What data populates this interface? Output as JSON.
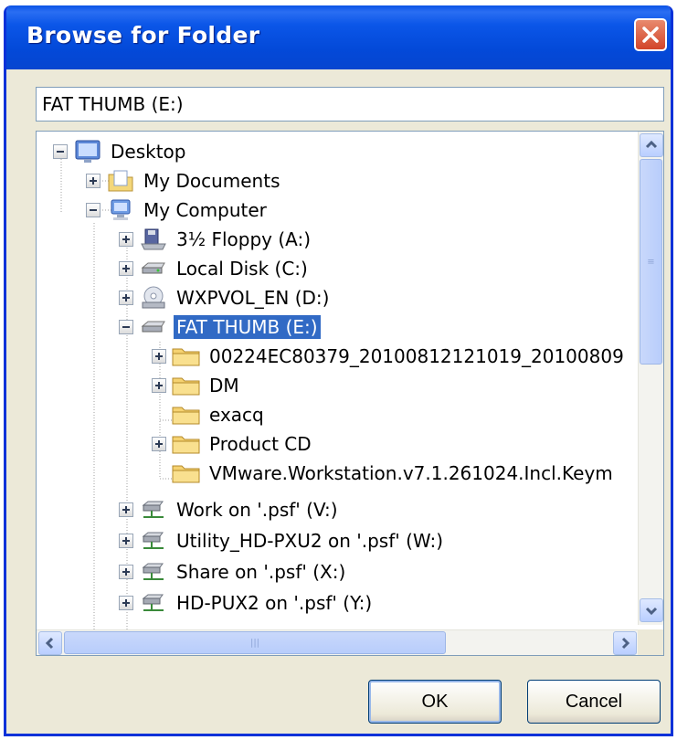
{
  "window": {
    "title": "Browse for Folder"
  },
  "path_field": {
    "value": "FAT THUMB (E:)"
  },
  "tree": {
    "items": [
      {
        "label": "Desktop",
        "icon": "desktop-icon",
        "expander": "minus"
      },
      {
        "label": "My Documents",
        "icon": "my-documents-icon",
        "expander": "plus"
      },
      {
        "label": "My Computer",
        "icon": "my-computer-icon",
        "expander": "minus"
      },
      {
        "label": "3½ Floppy (A:)",
        "icon": "floppy-drive-icon",
        "expander": "plus"
      },
      {
        "label": "Local Disk (C:)",
        "icon": "hard-drive-icon",
        "expander": "plus"
      },
      {
        "label": "WXPVOL_EN (D:)",
        "icon": "cd-drive-icon",
        "expander": "plus"
      },
      {
        "label": "FAT THUMB (E:)",
        "icon": "removable-drive-icon",
        "expander": "minus",
        "selected": true
      },
      {
        "label": "00224EC80379_20100812121019_20100809",
        "icon": "folder-icon",
        "expander": "plus"
      },
      {
        "label": "DM",
        "icon": "folder-icon",
        "expander": "plus"
      },
      {
        "label": "exacq",
        "icon": "folder-icon",
        "expander": "none"
      },
      {
        "label": "Product CD",
        "icon": "folder-icon",
        "expander": "plus"
      },
      {
        "label": "VMware.Workstation.v7.1.261024.Incl.Keym",
        "icon": "folder-icon",
        "expander": "none"
      },
      {
        "label": "Work on '.psf' (V:)",
        "icon": "network-drive-icon",
        "expander": "plus"
      },
      {
        "label": "Utility_HD-PXU2 on '.psf' (W:)",
        "icon": "network-drive-icon",
        "expander": "plus"
      },
      {
        "label": "Share on '.psf' (X:)",
        "icon": "network-drive-icon",
        "expander": "plus"
      },
      {
        "label": "HD-PUX2 on '.psf' (Y:)",
        "icon": "network-drive-icon",
        "expander": "plus"
      }
    ]
  },
  "buttons": {
    "ok": "OK",
    "cancel": "Cancel"
  },
  "colors": {
    "titlebar": "#0349d8",
    "selection": "#316ac5",
    "close": "#d2452a"
  }
}
